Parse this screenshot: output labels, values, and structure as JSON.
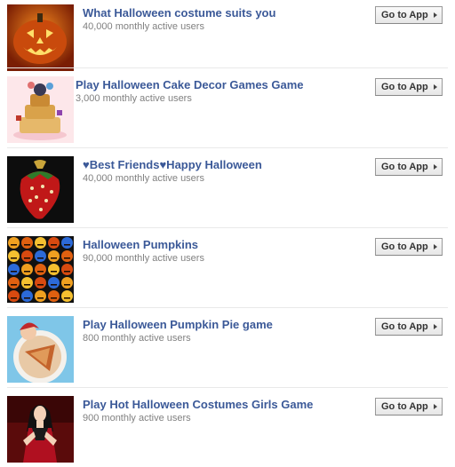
{
  "apps": [
    {
      "name": "What Halloween costume suits you",
      "users": "40,000 monthly active users",
      "button": "Go to App",
      "thumb": "pumpkin-thumbnail"
    },
    {
      "name": "Play Halloween Cake Decor Games Game",
      "users": "3,000 monthly active users",
      "button": "Go to App",
      "thumb": "cake-thumbnail"
    },
    {
      "name": "♥Best Friends♥Happy Halloween",
      "users": "40,000 monthly active users",
      "button": "Go to App",
      "thumb": "strawberry-charm-thumbnail"
    },
    {
      "name": "Halloween Pumpkins",
      "users": "90,000 monthly active users",
      "button": "Go to App",
      "thumb": "pumpkin-grid-thumbnail"
    },
    {
      "name": "Play Halloween Pumpkin Pie game",
      "users": "800 monthly active users",
      "button": "Go to App",
      "thumb": "pie-thumbnail"
    },
    {
      "name": "Play Hot Halloween Costumes Girls Game",
      "users": "900 monthly active users",
      "button": "Go to App",
      "thumb": "costume-girl-thumbnail"
    }
  ]
}
